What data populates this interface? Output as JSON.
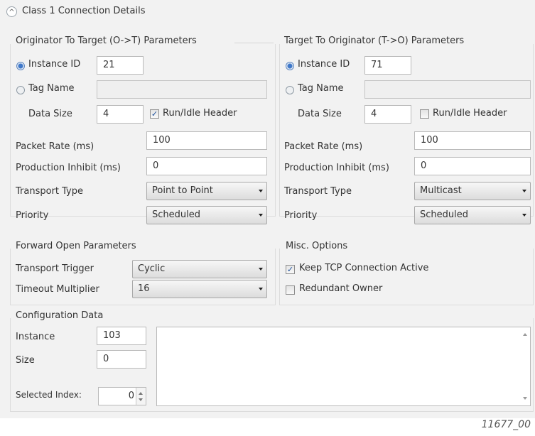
{
  "header": {
    "collapse_glyph": "^",
    "title": "Class 1 Connection Details"
  },
  "ot": {
    "title": "Originator To Target (O->T) Parameters",
    "instance_id_label": "Instance ID",
    "instance_id_value": "21",
    "instance_id_selected": true,
    "tag_name_label": "Tag Name",
    "tag_name_value": "",
    "data_size_label": "Data Size",
    "data_size_value": "4",
    "run_idle_label": "Run/Idle Header",
    "run_idle_checked": true,
    "packet_rate_label": "Packet Rate (ms)",
    "packet_rate_value": "100",
    "production_inhibit_label": "Production Inhibit (ms)",
    "production_inhibit_value": "0",
    "transport_type_label": "Transport Type",
    "transport_type_value": "Point to Point",
    "priority_label": "Priority",
    "priority_value": "Scheduled"
  },
  "to": {
    "title": "Target To Originator (T->O) Parameters",
    "instance_id_label": "Instance ID",
    "instance_id_value": "71",
    "instance_id_selected": true,
    "tag_name_label": "Tag Name",
    "tag_name_value": "",
    "data_size_label": "Data Size",
    "data_size_value": "4",
    "run_idle_label": "Run/Idle Header",
    "run_idle_checked": false,
    "packet_rate_label": "Packet Rate (ms)",
    "packet_rate_value": "100",
    "production_inhibit_label": "Production Inhibit (ms)",
    "production_inhibit_value": "0",
    "transport_type_label": "Transport Type",
    "transport_type_value": "Multicast",
    "priority_label": "Priority",
    "priority_value": "Scheduled"
  },
  "forward_open": {
    "title": "Forward Open Parameters",
    "transport_trigger_label": "Transport Trigger",
    "transport_trigger_value": "Cyclic",
    "timeout_multiplier_label": "Timeout Multiplier",
    "timeout_multiplier_value": "16"
  },
  "misc": {
    "title": "Misc. Options",
    "keep_tcp_label": "Keep TCP Connection Active",
    "keep_tcp_checked": true,
    "redundant_owner_label": "Redundant Owner",
    "redundant_owner_checked": false
  },
  "config": {
    "title": "Configuration Data",
    "instance_label": "Instance",
    "instance_value": "103",
    "size_label": "Size",
    "size_value": "0",
    "selected_index_label": "Selected Index:",
    "selected_index_value": "0"
  },
  "figure_id": "11677_00",
  "colors": {
    "panel_background": "#f2f2f2",
    "checkmark": "#1b4f9c",
    "radio_selected": "#3f78c9"
  },
  "icons": {
    "collapse": "collapse-icon",
    "combo_arrow": "chevron-down-icon",
    "checkmark": "checkmark-icon"
  }
}
